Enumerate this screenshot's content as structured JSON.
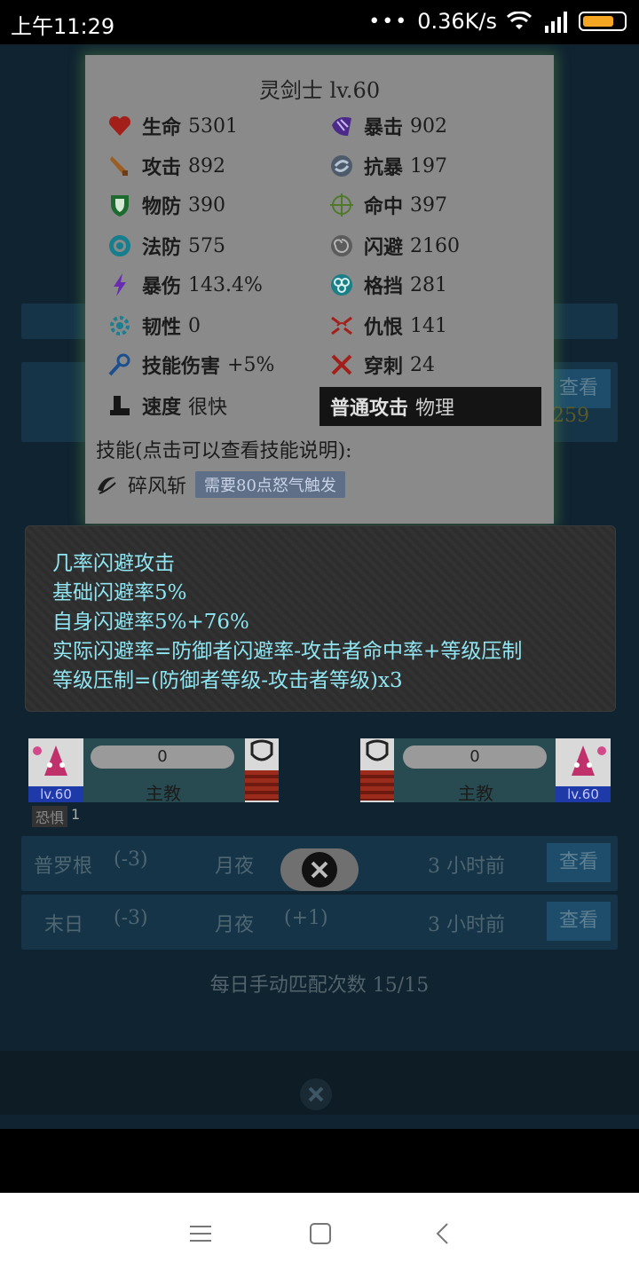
{
  "status_bar": {
    "time": "上午11:29",
    "dots": "•••",
    "speed": "0.36K/s"
  },
  "background": {
    "rows": [
      {
        "name": "普罗根",
        "score": "(-3)",
        "map": "月夜",
        "time": "3 小时前",
        "view": "查看"
      },
      {
        "name": "末日",
        "score": "(-3)",
        "map": "月夜",
        "change": "(+1)",
        "time": "3 小时前",
        "view": "查看"
      }
    ],
    "match_count": "每日手动匹配次数 15/15",
    "side_number": "259",
    "top_view": "查看"
  },
  "card": {
    "title": "灵剑士 lv.60",
    "stats_left": [
      {
        "label": "生命",
        "value": "5301",
        "icon": "heart-icon"
      },
      {
        "label": "攻击",
        "value": "892",
        "icon": "sword-icon"
      },
      {
        "label": "物防",
        "value": "390",
        "icon": "shield-icon"
      },
      {
        "label": "法防",
        "value": "575",
        "icon": "magic-shield-icon"
      },
      {
        "label": "暴伤",
        "value": "143.4%",
        "icon": "lightning-icon"
      },
      {
        "label": "韧性",
        "value": "0",
        "icon": "gear-icon"
      },
      {
        "label": "技能伤害",
        "value": "+5%",
        "icon": "wand-icon"
      },
      {
        "label": "速度",
        "value": "很快",
        "icon": "boot-icon"
      }
    ],
    "stats_right": [
      {
        "label": "暴击",
        "value": "902",
        "icon": "claw-icon"
      },
      {
        "label": "抗暴",
        "value": "197",
        "icon": "swirl-icon"
      },
      {
        "label": "命中",
        "value": "397",
        "icon": "crosshair-icon"
      },
      {
        "label": "闪避",
        "value": "2160",
        "icon": "vortex-icon"
      },
      {
        "label": "格挡",
        "value": "281",
        "icon": "knot-icon"
      },
      {
        "label": "仇恨",
        "value": "141",
        "icon": "rage-icon"
      },
      {
        "label": "穿刺",
        "value": "24",
        "icon": "cross-swords-icon"
      }
    ],
    "attack_type_label": "普通攻击",
    "attack_type_value": "物理",
    "skills_heading": "技能(点击可以查看技能说明):",
    "skill_name": "碎风斩",
    "skill_requirement": "需要80点怒气触发"
  },
  "tooltip": {
    "lines": [
      "几率闪避攻击",
      "基础闪避率5%",
      "自身闪避率5%+76%",
      "实际闪避率=防御者闪避率-攻击者命中率+等级压制",
      "等级压制=(防御者等级-攻击者等级)x3"
    ]
  },
  "battle": {
    "left": {
      "level": "lv.60",
      "hp": "0",
      "name": "主教"
    },
    "right": {
      "level": "lv.60",
      "hp": "0",
      "name": "主教"
    },
    "fear_label": "恐惧",
    "fear_count": "1"
  },
  "colors": {
    "tooltip_text": "#8fe6f2",
    "card_bg": "#8a8a8a",
    "attack_box": "#141414"
  }
}
